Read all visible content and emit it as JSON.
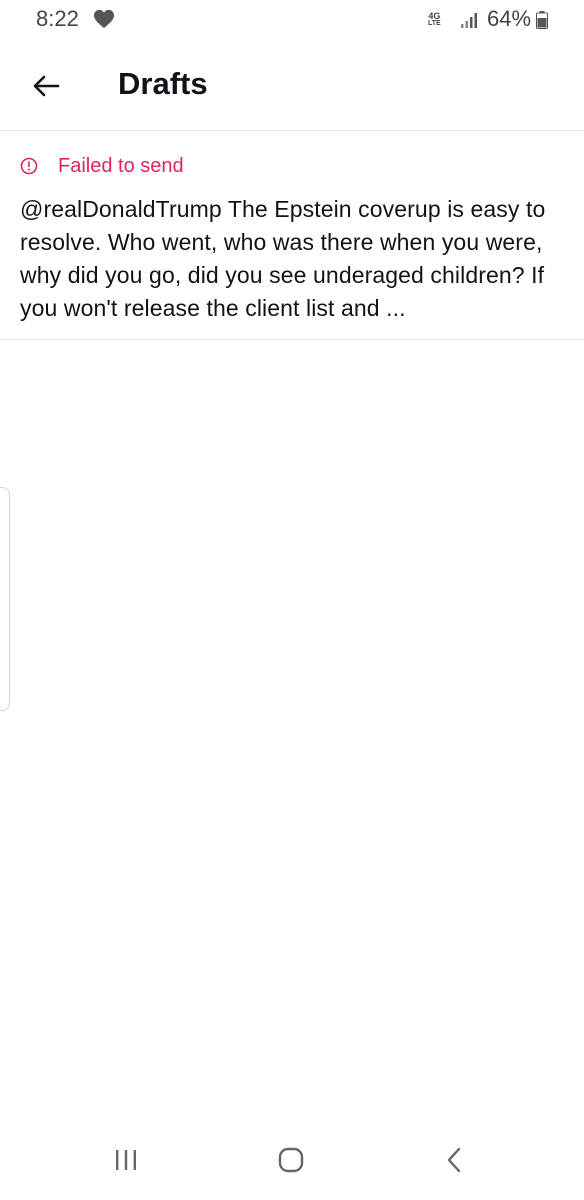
{
  "status_bar": {
    "time": "8:22",
    "network_top": "4G",
    "network_bottom": "LTE",
    "battery_percent": "64%",
    "icons": [
      "heart-icon",
      "signal-icon",
      "battery-icon"
    ]
  },
  "header": {
    "title": "Drafts",
    "back_icon": "arrow-left-icon"
  },
  "drafts": [
    {
      "status": "Failed to send",
      "status_icon": "alert-circle-icon",
      "text": "@realDonaldTrump The Epstein coverup is easy to resolve. Who went, who was there when you were, why did you go, did you see underaged children? If you won't release the client list and ..."
    }
  ],
  "nav_bar": {
    "icons": [
      "recent-apps-icon",
      "home-icon",
      "back-nav-icon"
    ]
  },
  "colors": {
    "error": "#e0245e",
    "text": "#0f1419",
    "divider": "#e6e9eb",
    "status_gray": "#444444"
  }
}
